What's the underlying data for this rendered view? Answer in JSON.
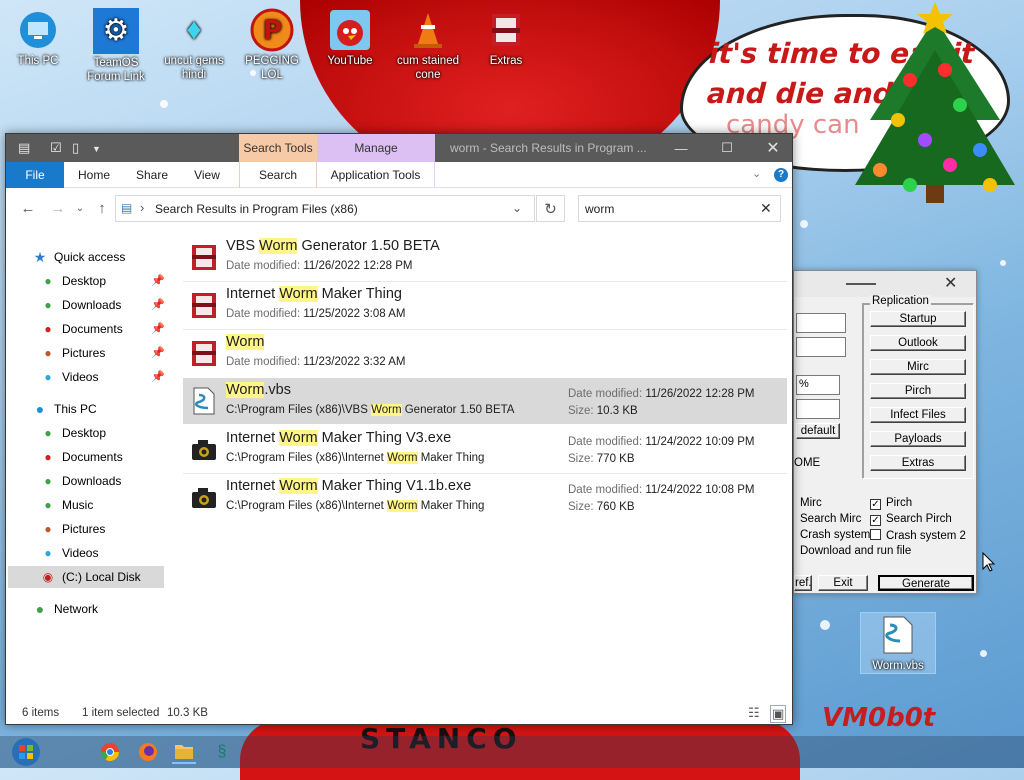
{
  "desktop": {
    "icons": [
      {
        "label": "This PC"
      },
      {
        "label": "TeamOS Forum Link"
      },
      {
        "label": "uncut gems hindi"
      },
      {
        "label": "PEGGING LOL"
      },
      {
        "label": "YouTube"
      },
      {
        "label": "cum stained cone"
      },
      {
        "label": "Extras"
      },
      {
        "label": "Worm.vbs"
      }
    ],
    "bubble_line1": "it's time to eat it",
    "bubble_line2": "and die and e",
    "bubble_line3": "candy can",
    "banner_text": "STANCO",
    "signature": "VM0b0t"
  },
  "explorer": {
    "tab_search_tools": "Search Tools",
    "tab_manage": "Manage",
    "title": "worm - Search Results in Program ...",
    "ribbon": {
      "file": "File",
      "home": "Home",
      "share": "Share",
      "view": "View",
      "search": "Search",
      "application_tools": "Application Tools"
    },
    "address": "Search Results in Program Files (x86)",
    "search_value": "worm",
    "nav": {
      "quick_access": "Quick access",
      "qa_items": [
        "Desktop",
        "Downloads",
        "Documents",
        "Pictures",
        "Videos"
      ],
      "this_pc": "This PC",
      "pc_items": [
        "Desktop",
        "Documents",
        "Downloads",
        "Music",
        "Pictures",
        "Videos",
        "(C:) Local Disk"
      ],
      "network": "Network"
    },
    "results": [
      {
        "pre": "VBS ",
        "hl": "Worm",
        "post": " Generator 1.50 BETA",
        "sub_label": "Date modified:",
        "sub_value": "11/26/2022 12:28 PM",
        "type": "folder"
      },
      {
        "pre": "Internet ",
        "hl": "Worm",
        "post": " Maker Thing",
        "sub_label": "Date modified:",
        "sub_value": "11/25/2022 3:08 AM",
        "type": "folder"
      },
      {
        "pre": "",
        "hl": "Worm",
        "post": "",
        "sub_label": "Date modified:",
        "sub_value": "11/23/2022 3:32 AM",
        "type": "folder"
      },
      {
        "pre": "",
        "hl": "Worm",
        "post": ".vbs",
        "path_pre": "C:\\Program Files (x86)\\VBS ",
        "path_hl": "Worm",
        "path_post": " Generator 1.50 BETA",
        "date_label": "Date modified:",
        "date": "11/26/2022 12:28 PM",
        "size_label": "Size:",
        "size": "10.3 KB",
        "type": "script"
      },
      {
        "pre": "Internet ",
        "hl": "Worm",
        "post": " Maker Thing V3.exe",
        "path_pre": "C:\\Program Files (x86)\\Internet ",
        "path_hl": "Worm",
        "path_post": " Maker Thing",
        "date_label": "Date modified:",
        "date": "11/24/2022 10:09 PM",
        "size_label": "Size:",
        "size": "770 KB",
        "type": "exe"
      },
      {
        "pre": "Internet ",
        "hl": "Worm",
        "post": " Maker Thing V1.1b.exe",
        "path_pre": "C:\\Program Files (x86)\\Internet ",
        "path_hl": "Worm",
        "path_post": " Maker Thing",
        "date_label": "Date modified:",
        "date": "11/24/2022 10:08 PM",
        "size_label": "Size:",
        "size": "760 KB",
        "type": "exe"
      }
    ],
    "status": {
      "items": "6 items",
      "selected": "1 item selected",
      "size": "10.3 KB"
    }
  },
  "bgwin": {
    "replication": "Replication",
    "buttons": [
      "Startup",
      "Outlook",
      "Mirc",
      "Pirch",
      "Infect Files",
      "Payloads",
      "Extras"
    ],
    "left_frag": {
      "pct": "%",
      "default": "default",
      "ome": "OME"
    },
    "checks": [
      {
        "label": "Mirc",
        "checked": false
      },
      {
        "label": "Pirch",
        "checked": true
      },
      {
        "label": "Search Mirc",
        "checked": false
      },
      {
        "label": "Search Pirch",
        "checked": true
      },
      {
        "label": "Crash system",
        "checked": false
      },
      {
        "label": "Crash system 2",
        "checked": false
      },
      {
        "label": "Download and run file",
        "checked": false
      }
    ],
    "ref": "ref.",
    "exit": "Exit",
    "generate": "Generate"
  },
  "colors": {
    "accent": "#1979ca",
    "highlight": "#fff58a",
    "search_tools_tab": "#f5c9a8",
    "manage_tab": "#d9b8f0"
  }
}
